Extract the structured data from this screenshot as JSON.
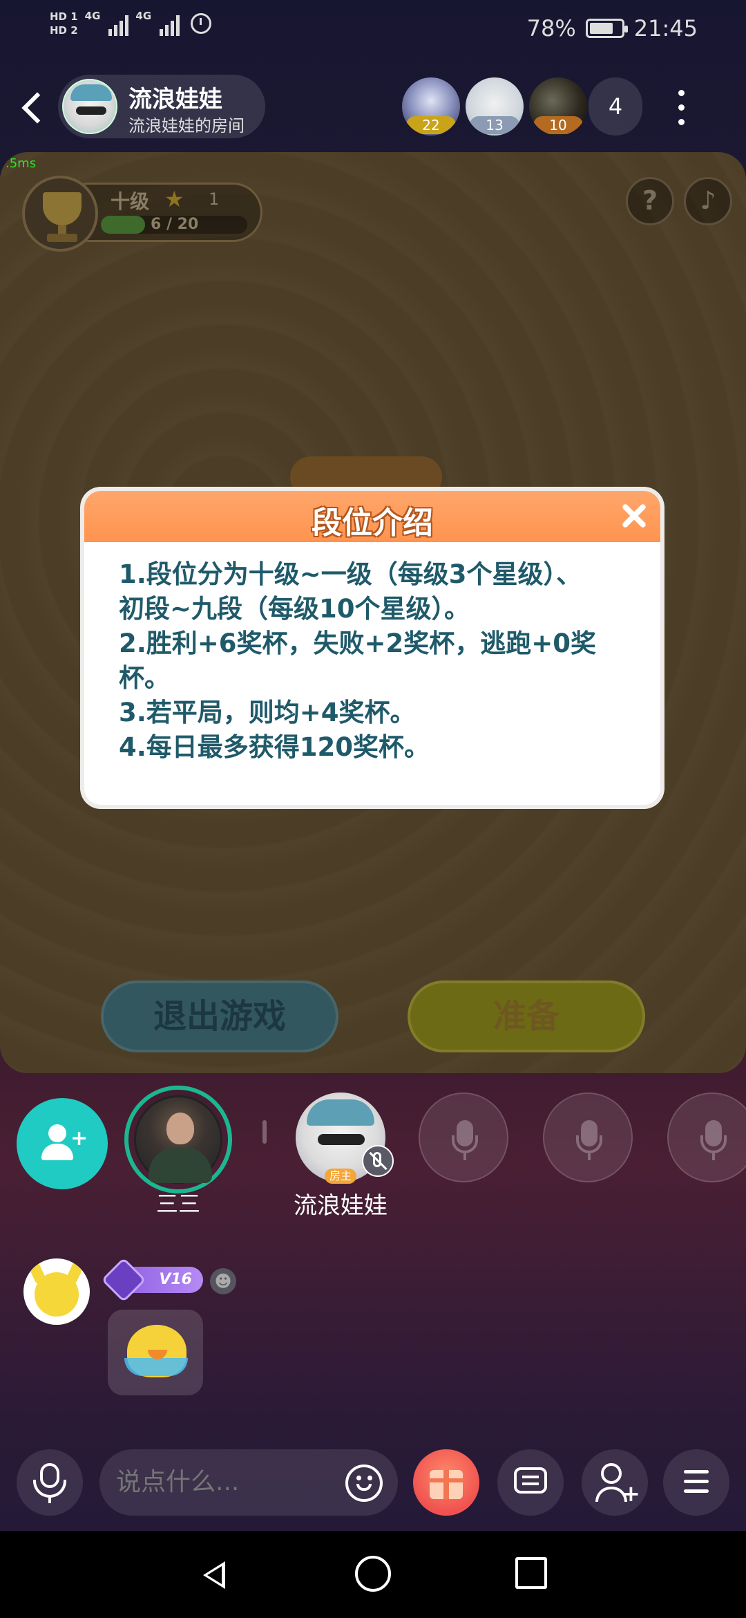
{
  "status_bar": {
    "hd1": "HD 1",
    "hd2": "HD 2",
    "network1": "4G",
    "network2": "4G",
    "battery_percent": "78%",
    "battery_level": 0.78,
    "time": "21:45"
  },
  "header": {
    "room_title": "流浪娃娃",
    "room_subtitle": "流浪娃娃的房间",
    "audience": [
      {
        "count": "22"
      },
      {
        "count": "13"
      },
      {
        "count": "10"
      }
    ],
    "audience_total": "4"
  },
  "game": {
    "fps_label": ".5ms",
    "rank_level": "十级",
    "star_icon": "★",
    "stars": "1",
    "progress_text": "6 / 20",
    "progress_fraction": 0.3,
    "help_icon": "?",
    "music_icon": "♪",
    "exit_label": "退出游戏",
    "ready_label": "准备"
  },
  "modal": {
    "title": "段位介绍",
    "rules": [
      "1.段位分为十级~一级（每级3个星级）、",
      "初段~九段（每级10个星级）。",
      "2.胜利+6奖杯，失败+2奖杯，逃跑+0奖",
      "杯。",
      "3.若平局，则均+4奖杯。",
      "4.每日最多获得120奖杯。"
    ]
  },
  "seats": {
    "seat1_name": "三三",
    "host_name": "流浪娃娃",
    "host_tag": "房主"
  },
  "chat": {
    "vip_level": "V16",
    "emoji_face": "☻"
  },
  "bottom_bar": {
    "input_placeholder": "说点什么..."
  },
  "colors": {
    "modal_header": "#ff944f",
    "modal_text": "#1f5a6a",
    "invite_teal": "#1fcbc2",
    "gift_red": "#f0524f"
  }
}
